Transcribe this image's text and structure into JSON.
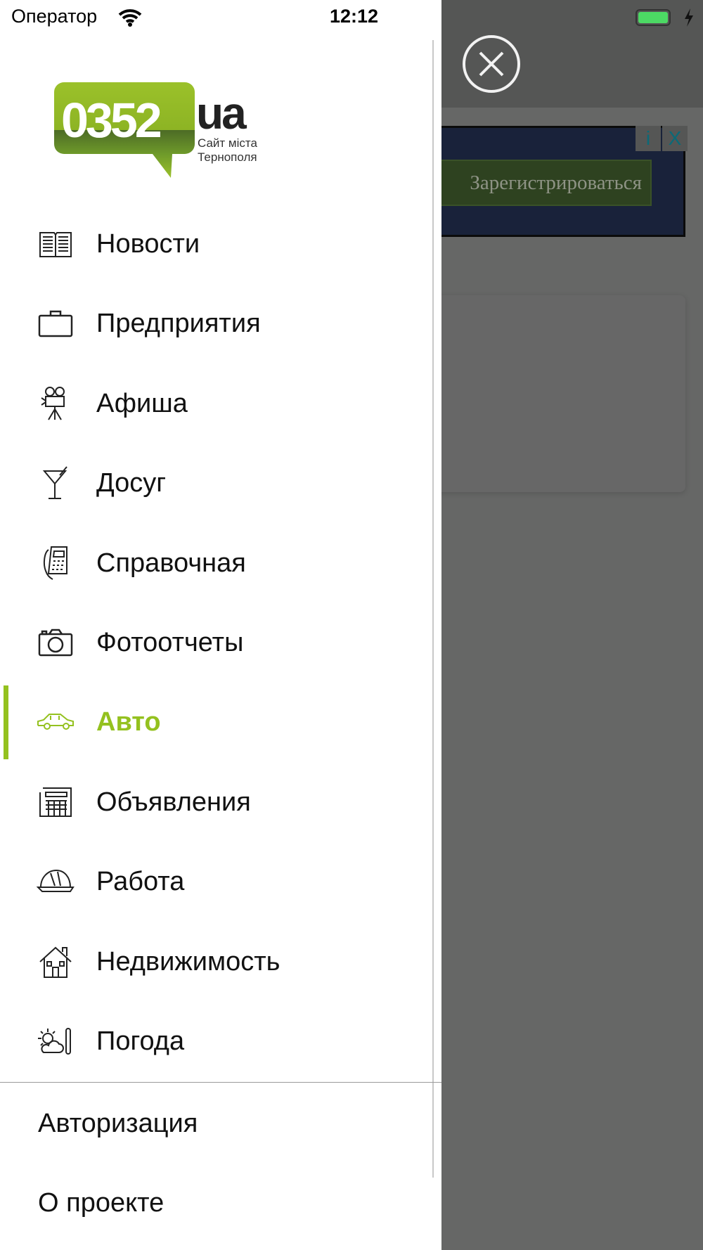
{
  "status_bar": {
    "carrier": "Оператор",
    "time": "12:12",
    "battery_level": 1.0
  },
  "logo": {
    "number": "0352",
    "suffix": "ua",
    "tagline_1": "Сайт міста",
    "tagline_2": "Тернополя"
  },
  "menu": {
    "items": [
      {
        "label": "Новости",
        "icon": "newspaper-icon"
      },
      {
        "label": "Предприятия",
        "icon": "briefcase-icon"
      },
      {
        "label": "Афиша",
        "icon": "film-camera-icon"
      },
      {
        "label": "Досуг",
        "icon": "cocktail-icon"
      },
      {
        "label": "Справочная",
        "icon": "phone-icon"
      },
      {
        "label": "Фотоотчеты",
        "icon": "camera-icon"
      },
      {
        "label": "Авто",
        "icon": "car-icon",
        "active": true
      },
      {
        "label": "Объявления",
        "icon": "classifieds-icon"
      },
      {
        "label": "Работа",
        "icon": "hard-hat-icon"
      },
      {
        "label": "Недвижимость",
        "icon": "house-icon"
      },
      {
        "label": "Погода",
        "icon": "weather-icon"
      }
    ]
  },
  "bottom_links": [
    "Авторизация",
    "О проекте"
  ],
  "ad": {
    "button_label": "Зарегистрироваться",
    "info": "i",
    "close": "X"
  },
  "colors": {
    "accent": "#94c11f",
    "overlay": "#666766"
  }
}
